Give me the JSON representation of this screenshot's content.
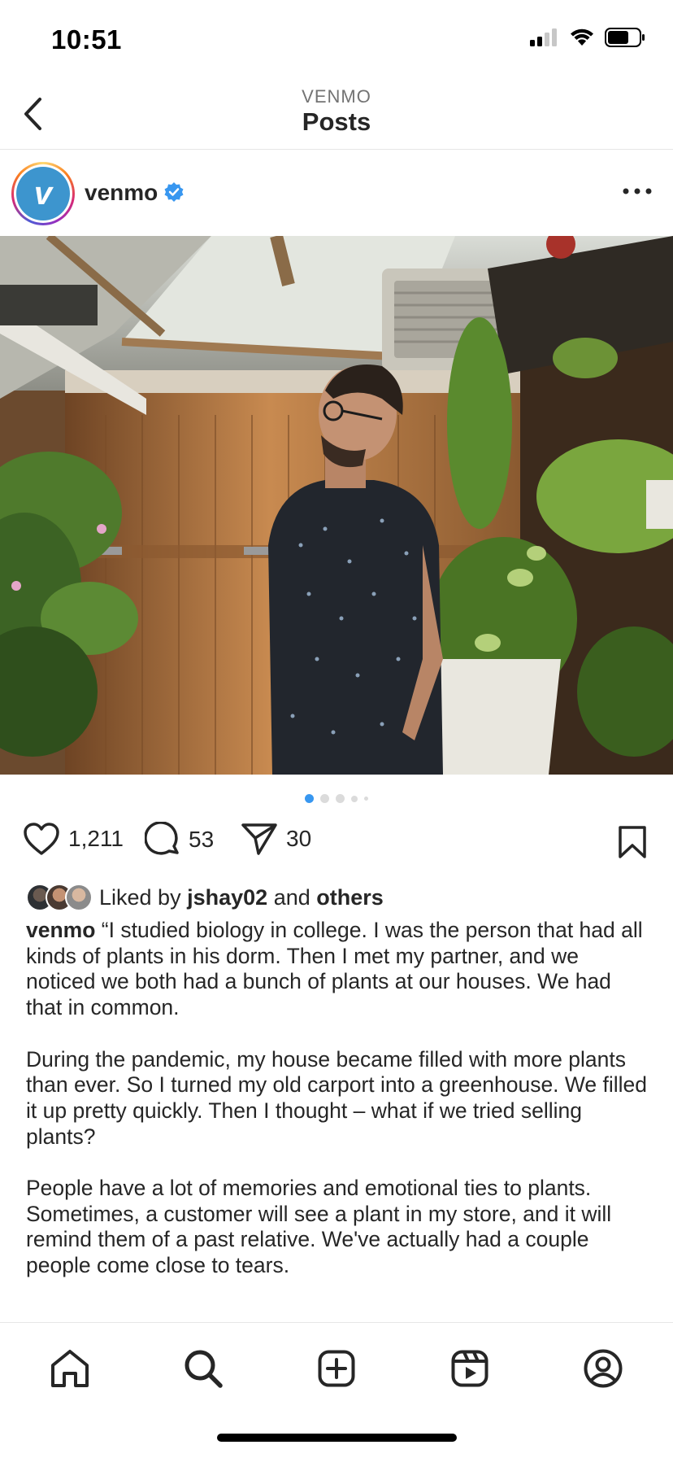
{
  "status_bar": {
    "time": "10:51"
  },
  "nav": {
    "subtitle": "VENMO",
    "title": "Posts"
  },
  "post": {
    "username": "venmo",
    "avatar_letter": "v",
    "brand_color": "#3d95ce",
    "verified_color": "#3897f0",
    "image_description_icon": "photo-man-greenhouse",
    "carousel": {
      "total": 5,
      "active_index": 0
    },
    "likes_count": "1,211",
    "comments_count": "53",
    "shares_count": "30",
    "liked_by_prefix": "Liked by",
    "liked_by_user": "jshay02",
    "liked_by_and": "and",
    "liked_by_others": "others",
    "caption_user": "venmo",
    "caption_paragraphs": [
      "“I studied biology in college. I was the person that had all kinds of plants in his dorm. Then I met my partner, and we noticed we both had a bunch of plants at our houses. We had that in common.",
      "During the pandemic, my house became filled with more plants than ever. So I turned my old carport into a greenhouse. We filled it up pretty quickly. Then I thought – what if we tried selling plants?",
      "People have a lot of memories and emotional ties to plants. Sometimes, a customer will see a plant in my store, and it will remind them of a past relative. We've actually had a couple people come close to tears."
    ]
  },
  "tab_bar": {
    "items": [
      "home-icon",
      "search-icon",
      "create-icon",
      "reels-icon",
      "profile-icon"
    ]
  }
}
